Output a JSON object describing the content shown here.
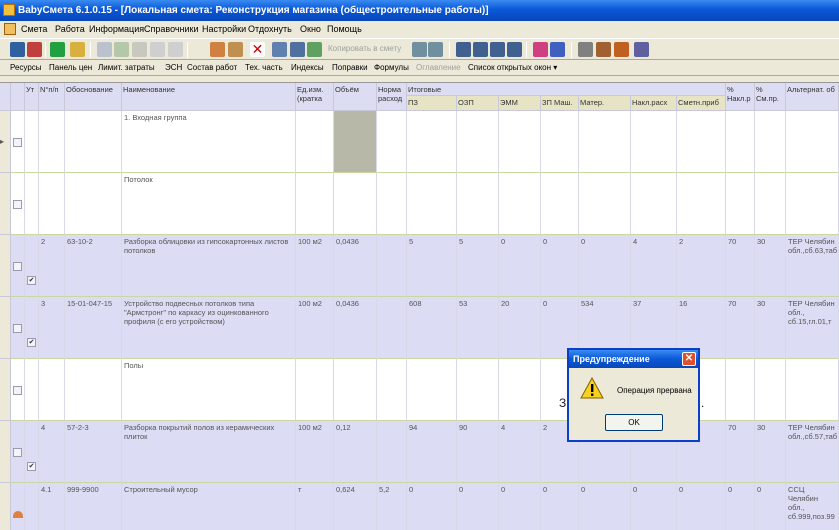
{
  "window": {
    "title": "BabyСмета  6.1.0.15  - [Локальная смета: Реконструкция магазина (общестроительные работы)]"
  },
  "menu": [
    "Смета",
    "Работа",
    "Информация",
    "Справочники",
    "Настройки",
    "Отдохнуть",
    "Окно",
    "Помощь"
  ],
  "toolbar": {
    "copy_label": "Копировать в смету"
  },
  "toolbar2": {
    "items": [
      "Ресурсы",
      "Панель цен",
      "Лимит. затраты",
      "ЭСН",
      "Состав работ",
      "Тех. часть",
      "Индексы",
      "Поправки",
      "Формулы",
      "Оглавление",
      "Список открытых окон ▾"
    ]
  },
  "grid": {
    "headers": {
      "ut": "Ут",
      "num": "N°п/п",
      "basis": "Обоснование",
      "name": "Наименование",
      "unit": "Ед.изм.(кратка",
      "volume": "Объём",
      "norm": "Норма расход",
      "totals": "Итоговые",
      "pz": "ПЗ",
      "ozp": "ОЗП",
      "emm": "ЭММ",
      "zpm": "ЗП Маш.",
      "mater": "Матер.",
      "nakl": "Накл.расх",
      "smetn": "Сметн.приб",
      "pnakl": "% Накл.р",
      "psm": "% См.пр.",
      "alt": "Альтернат. об"
    },
    "rows": [
      {
        "ut": "",
        "checked": false,
        "num": "",
        "basis": "",
        "name": "1. Входная группа",
        "unit": "",
        "volume": "",
        "norm": "",
        "pz": "",
        "ozp": "",
        "emm": "",
        "zpm": "",
        "mater": "",
        "nakl": "",
        "smetn": "",
        "pnakl": "",
        "psm": "",
        "alt": "",
        "section": true
      },
      {
        "ut": "",
        "checked": false,
        "num": "",
        "basis": "",
        "name": "Потолок",
        "unit": "",
        "volume": "",
        "norm": "",
        "pz": "",
        "ozp": "",
        "emm": "",
        "zpm": "",
        "mater": "",
        "nakl": "",
        "smetn": "",
        "pnakl": "",
        "psm": "",
        "alt": "",
        "section": true
      },
      {
        "ut": "✔",
        "checked": true,
        "num": "2",
        "basis": "63-10-2",
        "name": "Разборка облицовки из гипсокартонных листов потолков",
        "unit": "100 м2",
        "volume": "0,0436",
        "norm": "",
        "pz": "5",
        "ozp": "5",
        "emm": "0",
        "zpm": "0",
        "mater": "0",
        "nakl": "4",
        "smetn": "2",
        "pnakl": "70",
        "psm": "30",
        "alt": "ТЕР Челябин обл.,сб.63,таб"
      },
      {
        "ut": "✔",
        "checked": true,
        "num": "3",
        "basis": "15-01-047-15",
        "name": "Устройство подвесных потолков типа \"Армстронг\" по каркасу из оцинкованного профиля (с его устройством)",
        "unit": "100 м2",
        "volume": "0,0436",
        "norm": "",
        "pz": "608",
        "ozp": "53",
        "emm": "20",
        "zpm": "0",
        "mater": "534",
        "nakl": "37",
        "smetn": "16",
        "pnakl": "70",
        "psm": "30",
        "alt": "ТЕР Челябин обл., сб.15,гл.01,т"
      },
      {
        "ut": "",
        "checked": false,
        "num": "",
        "basis": "",
        "name": "Полы",
        "unit": "",
        "volume": "",
        "norm": "",
        "pz": "",
        "ozp": "",
        "emm": "",
        "zpm": "",
        "mater": "",
        "nakl": "",
        "smetn": "",
        "pnakl": "",
        "psm": "",
        "alt": "",
        "section": true
      },
      {
        "ut": "✔",
        "checked": true,
        "num": "4",
        "basis": "57-2-3",
        "name": "Разборка покрытий полов из керамических плиток",
        "unit": "100 м2",
        "volume": "0,12",
        "norm": "",
        "pz": "94",
        "ozp": "90",
        "emm": "4",
        "zpm": "2",
        "mater": "",
        "nakl": "",
        "smetn": "",
        "pnakl": "70",
        "psm": "30",
        "alt": "ТЕР Челябин обл.,сб.57,таб"
      },
      {
        "ut": "",
        "checked": false,
        "num": "4.1",
        "basis": "999-9900",
        "name": "Строительный мусор",
        "unit": "т",
        "volume": "0,624",
        "norm": "5,2",
        "pz": "0",
        "ozp": "0",
        "emm": "0",
        "zpm": "0",
        "mater": "0",
        "nakl": "0",
        "smetn": "0",
        "pnakl": "0",
        "psm": "0",
        "alt": "ССЦ Челябин обл., сб.999,поз.99"
      }
    ]
  },
  "dialog": {
    "title": "Предупреждение",
    "message": "Операция прервана",
    "ok_label": "OK",
    "icon": "warning-icon"
  },
  "overlay_text": {
    "left": "З",
    "right": "."
  }
}
